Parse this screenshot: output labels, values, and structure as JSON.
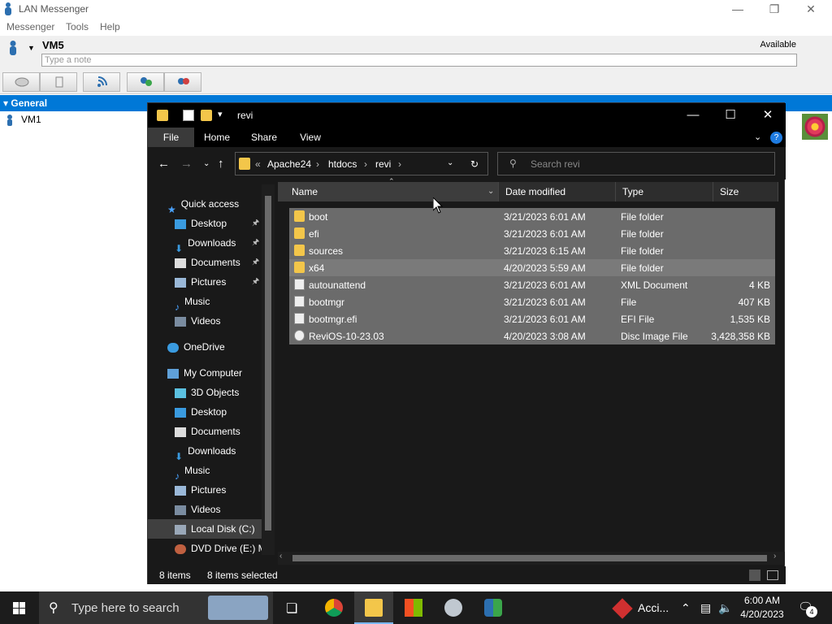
{
  "messenger": {
    "title": "LAN Messenger",
    "menu": [
      "Messenger",
      "Tools",
      "Help"
    ],
    "user_name": "VM5",
    "status": "Available",
    "note_placeholder": "Type a note",
    "group": "General",
    "contact": "VM1"
  },
  "explorer": {
    "title": "revi",
    "ribbon_tabs": [
      "File",
      "Home",
      "Share",
      "View"
    ],
    "breadcrumb_prefix": "«",
    "breadcrumb": [
      "Apache24",
      "htdocs",
      "revi"
    ],
    "search_placeholder": "Search revi",
    "quick_access": "Quick access",
    "quick_items": [
      "Desktop",
      "Downloads",
      "Documents",
      "Pictures",
      "Music",
      "Videos"
    ],
    "onedrive": "OneDrive",
    "my_computer": "My Computer",
    "pc_items": [
      "3D Objects",
      "Desktop",
      "Documents",
      "Downloads",
      "Music",
      "Pictures",
      "Videos",
      "Local Disk (C:)",
      "DVD Drive (E:) M"
    ],
    "columns": [
      "Name",
      "Date modified",
      "Type",
      "Size"
    ],
    "files": [
      {
        "name": "boot",
        "date": "3/21/2023 6:01 AM",
        "type": "File folder",
        "size": "",
        "kind": "folder"
      },
      {
        "name": "efi",
        "date": "3/21/2023 6:01 AM",
        "type": "File folder",
        "size": "",
        "kind": "folder"
      },
      {
        "name": "sources",
        "date": "3/21/2023 6:15 AM",
        "type": "File folder",
        "size": "",
        "kind": "folder"
      },
      {
        "name": "x64",
        "date": "4/20/2023 5:59 AM",
        "type": "File folder",
        "size": "",
        "kind": "folder"
      },
      {
        "name": "autounattend",
        "date": "3/21/2023 6:01 AM",
        "type": "XML Document",
        "size": "4 KB",
        "kind": "doc"
      },
      {
        "name": "bootmgr",
        "date": "3/21/2023 6:01 AM",
        "type": "File",
        "size": "407 KB",
        "kind": "doc"
      },
      {
        "name": "bootmgr.efi",
        "date": "3/21/2023 6:01 AM",
        "type": "EFI File",
        "size": "1,535 KB",
        "kind": "doc"
      },
      {
        "name": "ReviOS-10-23.03",
        "date": "4/20/2023 3:08 AM",
        "type": "Disc Image File",
        "size": "3,428,358 KB",
        "kind": "doc"
      }
    ],
    "status_items": "8 items",
    "status_selected": "8 items selected"
  },
  "taskbar": {
    "search_placeholder": "Type here to search",
    "tray_app_label": "Acci...",
    "time": "6:00 AM",
    "date": "4/20/2023",
    "notification_count": "4"
  },
  "colors": {
    "accent": "#0078d7",
    "folder": "#f3c64a",
    "explorer_bg": "#191919",
    "selection": "#6b6b6b"
  }
}
